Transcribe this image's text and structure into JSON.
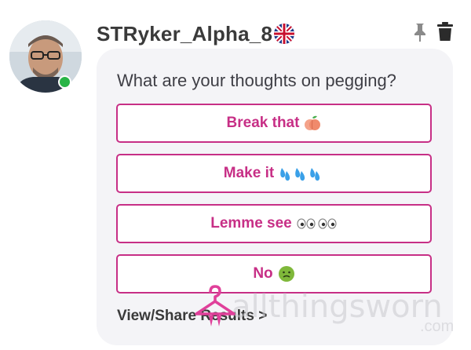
{
  "post": {
    "username": "STRyker_Alpha_8",
    "flag_icon": "uk-flag-icon",
    "online": true
  },
  "actions": {
    "pin_icon": "pin-icon",
    "delete_icon": "trash-icon"
  },
  "poll": {
    "question": "What are your thoughts on pegging?",
    "options": [
      {
        "label": "Break that",
        "emoji": "peach"
      },
      {
        "label": "Make it",
        "emoji": "sweat-droplets x3"
      },
      {
        "label": "Lemme see",
        "emoji": "eyes x2"
      },
      {
        "label": "No",
        "emoji": "nauseated-face"
      }
    ],
    "view_results_label": "View/Share Results >"
  },
  "watermark": {
    "text": "allthingsworn",
    "suffix": ".com"
  },
  "colors": {
    "accent": "#c72f86",
    "card_bg": "#f4f4f7",
    "text_dark": "#3a3a3a",
    "online_green": "#28b446"
  }
}
